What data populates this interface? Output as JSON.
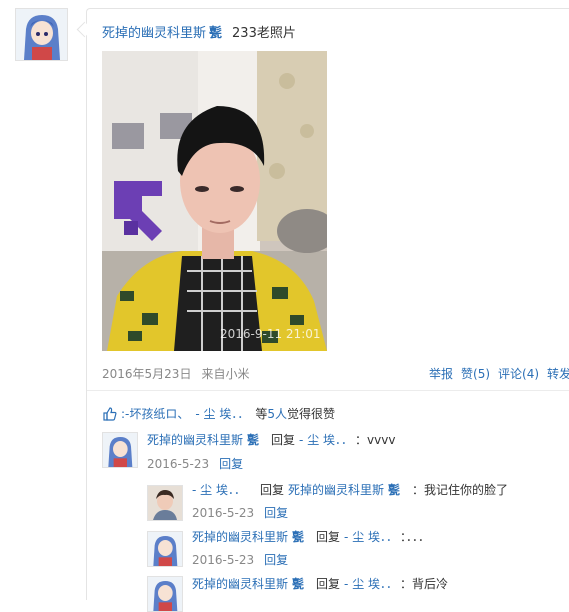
{
  "post": {
    "author": "死掉的幽灵科里斯",
    "author_badge": "甏",
    "content": "233老照片",
    "photo_stamp": "2016-9-11 21:01",
    "date": "2016年5月23日",
    "source": "来自小米",
    "actions": {
      "report": "举报",
      "like": "赞(5)",
      "comment": "评论(4)",
      "forward": "转发"
    }
  },
  "likes": {
    "users": [
      ":-坏孩纸ロ、",
      "- 尘 埃．．"
    ],
    "suffix_prefix": "等",
    "count": "5人",
    "suffix": "觉得很赞"
  },
  "comments": [
    {
      "author": "死掉的幽灵科里斯",
      "badge": "甏",
      "reply_word": "回复",
      "target": "- 尘 埃．．",
      "text": "：vvvv",
      "date": "2016-5-23",
      "reply_label": "回复"
    },
    {
      "author": "- 尘 埃．．",
      "badge": "",
      "reply_word": "回复",
      "target": "死掉的幽灵科里斯",
      "target_badge": "甏",
      "text": "：我记住你的脸了",
      "date": "2016-5-23",
      "reply_label": "回复"
    },
    {
      "author": "死掉的幽灵科里斯",
      "badge": "甏",
      "reply_word": "回复",
      "target": "- 尘 埃．．",
      "text": "：．．．",
      "date": "2016-5-23",
      "reply_label": "回复"
    },
    {
      "author": "死掉的幽灵科里斯",
      "badge": "甏",
      "reply_word": "回复",
      "target": "- 尘 埃．．",
      "text": "：背后冷"
    }
  ],
  "colors": {
    "link": "#2b6fb6",
    "meta": "#888888",
    "border": "#e4e4e4"
  }
}
